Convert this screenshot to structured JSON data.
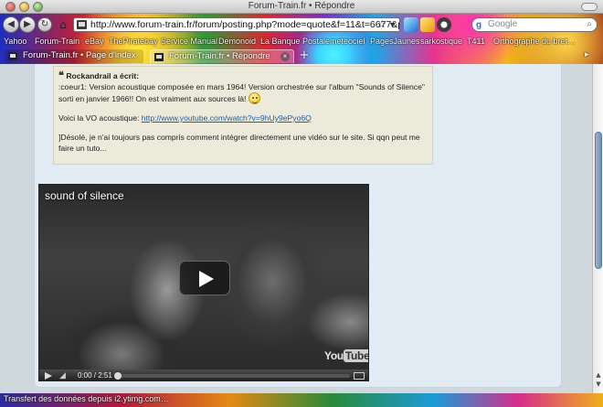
{
  "window": {
    "title": "Forum-Train.fr • Répondre"
  },
  "toolbar": {
    "url": "http://www.forum-train.fr/forum/posting.php?mode=quote&f=11&t=6677&p=145",
    "search_placeholder": "Google",
    "back_icon": "back-arrow-icon",
    "forward_icon": "forward-arrow-icon",
    "reload_icon": "reload-icon",
    "home_icon": "home-icon"
  },
  "bookmarks": [
    "Yahoo",
    "Forum-Train",
    "eBay",
    "ThePiratebay",
    "Service Manual",
    "Demonoid",
    "La Banque Postale",
    "meteociel",
    "PagesJaunes",
    "sarkostique",
    "T411",
    "Orthographe du bret…"
  ],
  "tabs": [
    {
      "label": "Forum-Train.fr • Page d'index",
      "active": false
    },
    {
      "label": "Forum-Train.fr • Répondre",
      "active": true
    }
  ],
  "quote": {
    "author_line": "Rockandrail a écrit:",
    "line1": ":coeur1: Version acoustique composée en mars 1964! Version orchestrée sur l'album \"Sounds of Silence\"",
    "line2": "sorti en janvier 1966!! On est vraiment aux sources là!",
    "link_prefix": "Voici la VO acoustique: ",
    "link": "http://www.youtube.com/watch?v=9hUy9ePyo6Q",
    "text1": "]Désolé, je n'ai toujours pas compris comment intégrer directement une vidéo sur le site. Si qqn peut me",
    "text2": "faire un tuto..."
  },
  "video": {
    "title": "sound of silence",
    "time": "0:00 / 2:51",
    "logo": "You",
    "logo_tube": "Tube",
    "progress": 0
  },
  "status": {
    "text": "Transfert des données depuis i2.ytimg.com…"
  },
  "colors": {
    "page_bg": "#cfd8dd",
    "post_bg": "#e0ebf4",
    "quote_bg": "#ebeadb",
    "link": "#1a5fa8"
  }
}
